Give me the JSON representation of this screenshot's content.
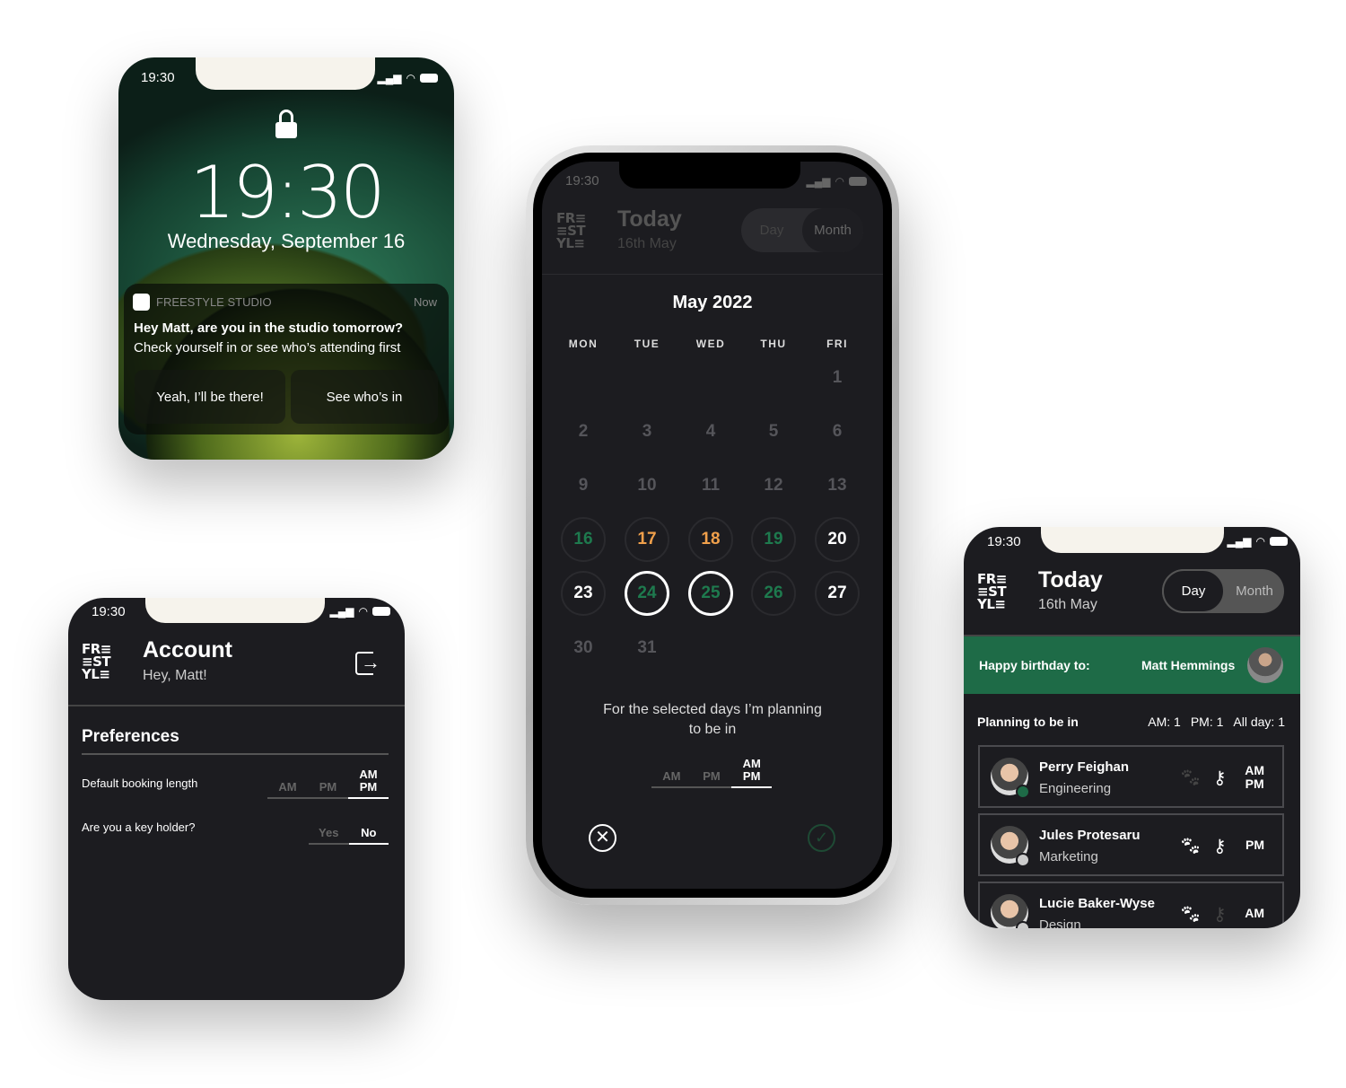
{
  "status_time": "19:30",
  "colors": {
    "green": "#1e6b47",
    "orange": "#f0a04b",
    "bg": "#1c1c20"
  },
  "lock": {
    "time": "19:30",
    "date": "Wednesday, September 16",
    "notification": {
      "app": "FREESTYLE STUDIO",
      "when": "Now",
      "title": "Hey Matt, are you in the studio tomorrow?",
      "body": "Check yourself in or see who’s attending first",
      "actions": [
        "Yeah, I’ll be there!",
        "See who’s in"
      ]
    }
  },
  "logo": {
    "l1": "FR≡",
    "l2": "≡ST",
    "l3": "YL≡"
  },
  "calendar": {
    "title": "Today",
    "date": "16th May",
    "toggle": [
      "Day",
      "Month"
    ],
    "month": "May 2022",
    "weekdays": [
      "MON",
      "TUE",
      "WED",
      "THU",
      "FRI"
    ],
    "days": [
      {
        "n": "1",
        "c": 4,
        "r": 0,
        "s": "dim"
      },
      {
        "n": "2",
        "c": 0,
        "r": 1,
        "s": "dim"
      },
      {
        "n": "3",
        "c": 1,
        "r": 1,
        "s": "dim"
      },
      {
        "n": "4",
        "c": 2,
        "r": 1,
        "s": "dim"
      },
      {
        "n": "5",
        "c": 3,
        "r": 1,
        "s": "dim"
      },
      {
        "n": "6",
        "c": 4,
        "r": 1,
        "s": "dim"
      },
      {
        "n": "9",
        "c": 0,
        "r": 2,
        "s": "dim"
      },
      {
        "n": "10",
        "c": 1,
        "r": 2,
        "s": "dim"
      },
      {
        "n": "11",
        "c": 2,
        "r": 2,
        "s": "dim"
      },
      {
        "n": "12",
        "c": 3,
        "r": 2,
        "s": "dim"
      },
      {
        "n": "13",
        "c": 4,
        "r": 2,
        "s": "dim"
      },
      {
        "n": "16",
        "c": 0,
        "r": 3,
        "s": "green"
      },
      {
        "n": "17",
        "c": 1,
        "r": 3,
        "s": "orange"
      },
      {
        "n": "18",
        "c": 2,
        "r": 3,
        "s": "orange"
      },
      {
        "n": "19",
        "c": 3,
        "r": 3,
        "s": "green"
      },
      {
        "n": "20",
        "c": 4,
        "r": 3,
        "s": "white"
      },
      {
        "n": "23",
        "c": 0,
        "r": 4,
        "s": "white"
      },
      {
        "n": "24",
        "c": 1,
        "r": 4,
        "s": "green-selected"
      },
      {
        "n": "25",
        "c": 2,
        "r": 4,
        "s": "green-selected"
      },
      {
        "n": "26",
        "c": 3,
        "r": 4,
        "s": "green"
      },
      {
        "n": "27",
        "c": 4,
        "r": 4,
        "s": "white"
      },
      {
        "n": "30",
        "c": 0,
        "r": 5,
        "s": "dim"
      },
      {
        "n": "31",
        "c": 1,
        "r": 5,
        "s": "dim"
      }
    ],
    "prompt": "For the selected days I’m planning to be in",
    "options": [
      "AM",
      "PM",
      "AM PM"
    ],
    "selected_option": "AM PM"
  },
  "account": {
    "title": "Account",
    "greeting": "Hey, Matt!",
    "section": "Preferences",
    "booking_label": "Default booking length",
    "booking_options": [
      "AM",
      "PM",
      "AM PM"
    ],
    "booking_selected": "AM PM",
    "key_label": "Are you a key holder?",
    "key_options": [
      "Yes",
      "No"
    ],
    "key_selected": "No"
  },
  "today": {
    "title": "Today",
    "date": "16th May",
    "toggle": [
      "Day",
      "Month"
    ],
    "toggle_selected": "Day",
    "birthday_label": "Happy birthday to:",
    "birthday_name": "Matt Hemmings",
    "planning_label": "Planning to be in",
    "am": "AM: 1",
    "pm": "PM: 1",
    "allday": "All day: 1",
    "people": [
      {
        "name": "Perry Feighan",
        "dept": "Engineering",
        "pet": false,
        "key": true,
        "slot": "AM PM",
        "dot": "green"
      },
      {
        "name": "Jules Protesaru",
        "dept": "Marketing",
        "pet": true,
        "key": true,
        "slot": "PM",
        "dot": "grey"
      },
      {
        "name": "Lucie Baker-Wyse",
        "dept": "Design",
        "pet": true,
        "key": false,
        "slot": "AM",
        "dot": "grey"
      }
    ]
  }
}
